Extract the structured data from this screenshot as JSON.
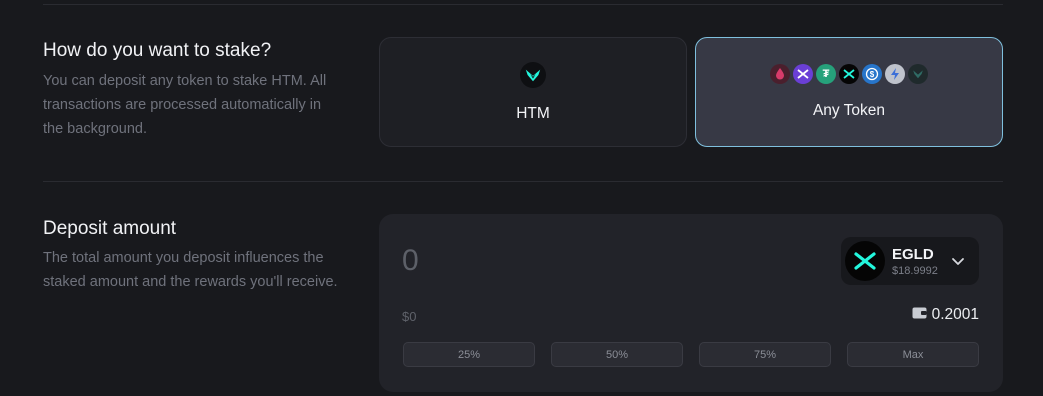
{
  "stake": {
    "title": "How do you want to stake?",
    "desc": "You can deposit any token to stake HTM. All transactions are processed automatically in the background.",
    "options": [
      {
        "label": "HTM",
        "icon": "htm-logo-icon",
        "selected": false
      },
      {
        "label": "Any Token",
        "icon": "token-stack-icon",
        "selected": true
      }
    ],
    "token_icons": [
      "pink-drop-icon",
      "multiversx-purple-icon",
      "tether-icon",
      "multiversx-icon",
      "usdc-icon",
      "bolt-icon",
      "htm-small-icon"
    ]
  },
  "deposit": {
    "title": "Deposit amount",
    "desc": "The total amount you deposit influences the staked amount and the rewards you'll receive.",
    "amount_placeholder": "0",
    "token": {
      "symbol": "EGLD",
      "price": "$18.9992",
      "icon": "egld-logo-icon"
    },
    "usd_value": "$0",
    "balance": "0.2001",
    "percent_buttons": [
      "25%",
      "50%",
      "75%",
      "Max"
    ]
  },
  "colors": {
    "background": "#18191d",
    "card": "#1e1f24",
    "selected_card": "#373945",
    "selected_border": "#7fc0de",
    "accent": "#23f7dd"
  }
}
